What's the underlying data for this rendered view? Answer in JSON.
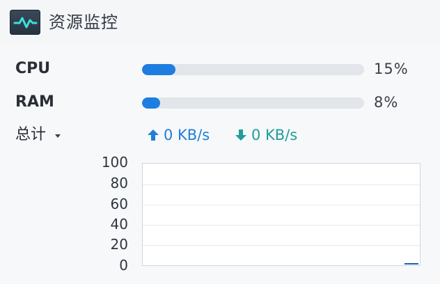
{
  "header": {
    "title": "资源监控",
    "icon": "activity-monitor-icon"
  },
  "cpu": {
    "label": "CPU",
    "percent_text": "15%",
    "value": 0.15
  },
  "ram": {
    "label": "RAM",
    "percent_text": "8%",
    "value": 0.08
  },
  "network": {
    "scope_label": "总计",
    "upload_text": "0 KB/s",
    "download_text": "0 KB/s",
    "upload_icon": "upload-arrow-icon",
    "download_icon": "download-arrow-icon"
  },
  "colors": {
    "bar_fill": "#1e7de0",
    "upload": "#1f7fd6",
    "download": "#1f9e9a"
  },
  "chart_data": {
    "type": "line",
    "y_ticks": [
      "100",
      "80",
      "60",
      "40",
      "20",
      "0"
    ],
    "ylim": [
      0,
      100
    ],
    "grid": true,
    "series": [
      {
        "values": [
          0,
          0
        ]
      }
    ]
  }
}
